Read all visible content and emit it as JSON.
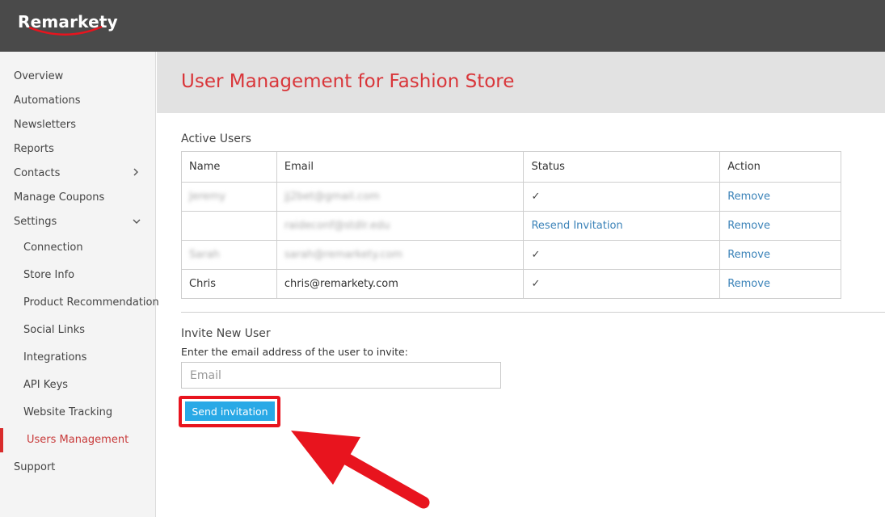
{
  "app": {
    "logo_text": "Remarkety"
  },
  "colors": {
    "topbar": "#4a4a4a",
    "accent_red": "#d9363a",
    "link_blue": "#3a82b8",
    "button_blue": "#29a9e6",
    "annotation_red": "#e8141e"
  },
  "sidebar": {
    "items": [
      {
        "label": "Overview"
      },
      {
        "label": "Automations"
      },
      {
        "label": "Newsletters"
      },
      {
        "label": "Reports"
      },
      {
        "label": "Contacts",
        "icon": "chevron-right-icon"
      },
      {
        "label": "Manage Coupons"
      },
      {
        "label": "Settings",
        "icon": "chevron-down-icon"
      }
    ],
    "settings_items": [
      {
        "label": "Connection"
      },
      {
        "label": "Store Info"
      },
      {
        "label": "Product Recommendation"
      },
      {
        "label": "Social Links"
      },
      {
        "label": "Integrations"
      },
      {
        "label": "API Keys"
      },
      {
        "label": "Website Tracking"
      },
      {
        "label": "Users Management",
        "active": true
      }
    ],
    "support_label": "Support"
  },
  "main": {
    "title": "User Management for Fashion Store",
    "active_users_heading": "Active Users",
    "table": {
      "headers": [
        "Name",
        "Email",
        "Status",
        "Action"
      ],
      "rows": [
        {
          "name": "Jeremy",
          "email": "jj2bet@gmail.com",
          "status": "✓",
          "action": "Remove",
          "blurred": true
        },
        {
          "name": "",
          "email": "raideconf@stdlr.edu",
          "status": "Resend Invitation",
          "action": "Remove",
          "blurred": true
        },
        {
          "name": "Sarah",
          "email": "sarah@remarkety.com",
          "status": "✓",
          "action": "Remove",
          "blurred": true
        },
        {
          "name": "Chris",
          "email": "chris@remarkety.com",
          "status": "✓",
          "action": "Remove",
          "blurred": false
        }
      ]
    },
    "invite": {
      "heading": "Invite New User",
      "description": "Enter the email address of the user to invite:",
      "email_placeholder": "Email",
      "email_value": "",
      "send_label": "Send invitation"
    }
  }
}
